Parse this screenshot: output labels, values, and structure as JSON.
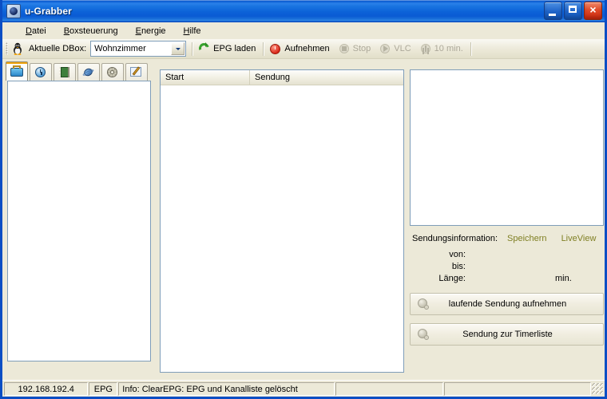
{
  "window": {
    "title": "u-Grabber",
    "app_icon": "app-window-icon",
    "buttons": {
      "minimize": "minimize-icon",
      "maximize": "maximize-icon",
      "close": "×"
    }
  },
  "menubar": {
    "items": [
      {
        "label": "Datei",
        "mnemonic": "D",
        "rest": "atei"
      },
      {
        "label": "Boxsteuerung",
        "mnemonic": "B",
        "rest": "oxsteuerung"
      },
      {
        "label": "Energie",
        "mnemonic": "E",
        "rest": "nergie"
      },
      {
        "label": "Hilfe",
        "mnemonic": "H",
        "rest": "ilfe"
      }
    ]
  },
  "toolbar": {
    "dbox_label": "Aktuelle DBox:",
    "dbox_value": "Wohnzimmer",
    "dbox_options": [
      "Wohnzimmer"
    ],
    "epg_laden": "EPG laden",
    "aufnehmen": "Aufnehmen",
    "stop": "Stop",
    "vlc": "VLC",
    "ten_min": "10 min."
  },
  "tabs": [
    {
      "name": "tv",
      "icon": "tv-icon",
      "active": true
    },
    {
      "name": "timer",
      "icon": "alarm-clock-icon",
      "active": false
    },
    {
      "name": "record",
      "icon": "film-strip-icon",
      "active": false
    },
    {
      "name": "sat",
      "icon": "satellite-icon",
      "active": false
    },
    {
      "name": "settings",
      "icon": "gear-icon",
      "active": false
    },
    {
      "name": "edit",
      "icon": "pencil-icon",
      "active": false
    }
  ],
  "channel_list": {
    "items": []
  },
  "program_list": {
    "columns": [
      "Start",
      "Sendung"
    ],
    "rows": []
  },
  "preview": {
    "content": ""
  },
  "info": {
    "title": "Sendungsinformation:",
    "save_link": "Speichern",
    "liveview_link": "LiveView",
    "von_label": "von:",
    "von_value": "",
    "bis_label": "bis:",
    "bis_value": "",
    "laenge_label": "Länge:",
    "laenge_value": "",
    "laenge_unit": "min."
  },
  "actions": {
    "record_current": "laufende Sendung aufnehmen",
    "add_to_timer": "Sendung zur Timerliste"
  },
  "statusbar": {
    "ip": "192.168.192.4",
    "mode": "EPG",
    "message": "Info: ClearEPG: EPG und Kanalliste gelöscht",
    "cell4": "",
    "cell5": ""
  },
  "colors": {
    "title_blue": "#0a5bd4",
    "face": "#ece9d8",
    "link_olive": "#7f7f23",
    "accent_orange": "#f0a30a"
  }
}
